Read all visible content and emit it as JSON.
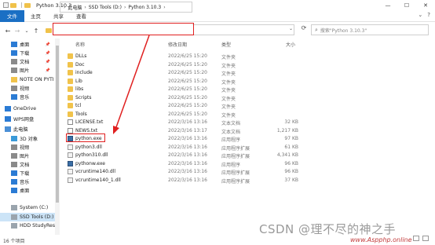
{
  "window": {
    "title": "Python 3.10.3",
    "controls": {
      "minimize": "—",
      "maximize": "☐",
      "close": "✕"
    }
  },
  "ribbon": {
    "tabs": [
      "文件",
      "主页",
      "共享",
      "查看"
    ],
    "expand": "⌄",
    "help": "?"
  },
  "nav": {
    "back": "←",
    "forward": "→",
    "recent": "⌄",
    "up": "↑",
    "breadcrumb": [
      "此电脑",
      "SSD Tools (D:)",
      "Python 3.10.3"
    ],
    "search_placeholder": "搜索\"Python 3.10.3\""
  },
  "sidebar": {
    "items": [
      {
        "label": "桌面",
        "icon": "desktop-icon",
        "pinned": true
      },
      {
        "label": "下载",
        "icon": "download-icon",
        "pinned": true
      },
      {
        "label": "文档",
        "icon": "document-icon",
        "pinned": true
      },
      {
        "label": "图片",
        "icon": "picture-icon",
        "pinned": true
      },
      {
        "label": "NOTE ON PYTI",
        "icon": "folder-icon"
      },
      {
        "label": "视频",
        "icon": "video-icon"
      },
      {
        "label": "音乐",
        "icon": "music-icon"
      },
      {
        "label": "OneDrive",
        "icon": "cloud-icon"
      },
      {
        "label": "WPS网盘",
        "icon": "cloud-icon"
      },
      {
        "label": "此电脑",
        "icon": "computer-icon"
      },
      {
        "label": "3D 对象",
        "icon": "cube-icon"
      },
      {
        "label": "视频",
        "icon": "video-icon"
      },
      {
        "label": "图片",
        "icon": "picture-icon"
      },
      {
        "label": "文档",
        "icon": "document-icon"
      },
      {
        "label": "下载",
        "icon": "download-icon"
      },
      {
        "label": "音乐",
        "icon": "music-icon"
      },
      {
        "label": "桌面",
        "icon": "desktop-icon"
      },
      {
        "label": "System (C:)",
        "icon": "drive-icon"
      },
      {
        "label": "SSD Tools (D:)",
        "icon": "drive-icon",
        "selected": true
      },
      {
        "label": "HDD StudyRes",
        "icon": "drive-icon"
      }
    ]
  },
  "columns": {
    "name": "名称",
    "date": "修改日期",
    "type": "类型",
    "size": "大小"
  },
  "files": [
    {
      "name": "DLLs",
      "date": "2022/6/25 15:20",
      "type": "文件夹",
      "size": "",
      "icon": "folder"
    },
    {
      "name": "Doc",
      "date": "2022/6/25 15:20",
      "type": "文件夹",
      "size": "",
      "icon": "folder"
    },
    {
      "name": "include",
      "date": "2022/6/25 15:20",
      "type": "文件夹",
      "size": "",
      "icon": "folder"
    },
    {
      "name": "Lib",
      "date": "2022/6/25 15:20",
      "type": "文件夹",
      "size": "",
      "icon": "folder"
    },
    {
      "name": "libs",
      "date": "2022/6/25 15:20",
      "type": "文件夹",
      "size": "",
      "icon": "folder"
    },
    {
      "name": "Scripts",
      "date": "2022/6/25 15:20",
      "type": "文件夹",
      "size": "",
      "icon": "folder"
    },
    {
      "name": "tcl",
      "date": "2022/6/25 15:20",
      "type": "文件夹",
      "size": "",
      "icon": "folder"
    },
    {
      "name": "Tools",
      "date": "2022/6/25 15:20",
      "type": "文件夹",
      "size": "",
      "icon": "folder"
    },
    {
      "name": "LICENSE.txt",
      "date": "2022/3/16 13:16",
      "type": "文本文档",
      "size": "32 KB",
      "icon": "doc"
    },
    {
      "name": "NEWS.txt",
      "date": "2022/3/16 13:17",
      "type": "文本文档",
      "size": "1,217 KB",
      "icon": "doc"
    },
    {
      "name": "python.exe",
      "date": "2022/3/16 13:16",
      "type": "应用程序",
      "size": "97 KB",
      "icon": "exe"
    },
    {
      "name": "python3.dll",
      "date": "2022/3/16 13:16",
      "type": "应用程序扩展",
      "size": "61 KB",
      "icon": "dll"
    },
    {
      "name": "python310.dll",
      "date": "2022/3/16 13:16",
      "type": "应用程序扩展",
      "size": "4,341 KB",
      "icon": "dll"
    },
    {
      "name": "pythonw.exe",
      "date": "2022/3/16 13:16",
      "type": "应用程序",
      "size": "96 KB",
      "icon": "exe"
    },
    {
      "name": "vcruntime140.dll",
      "date": "2022/3/16 13:16",
      "type": "应用程序扩展",
      "size": "96 KB",
      "icon": "dll"
    },
    {
      "name": "vcruntime140_1.dll",
      "date": "2022/3/16 13:16",
      "type": "应用程序扩展",
      "size": "37 KB",
      "icon": "dll"
    }
  ],
  "status": "16 个项目",
  "watermark": "CSDN @理不尽的神之手",
  "watermark_site": "www.Aspphp.online",
  "colors": {
    "accent": "#1a6fc4",
    "highlight": "#e02020",
    "selected": "#cce4f7"
  }
}
